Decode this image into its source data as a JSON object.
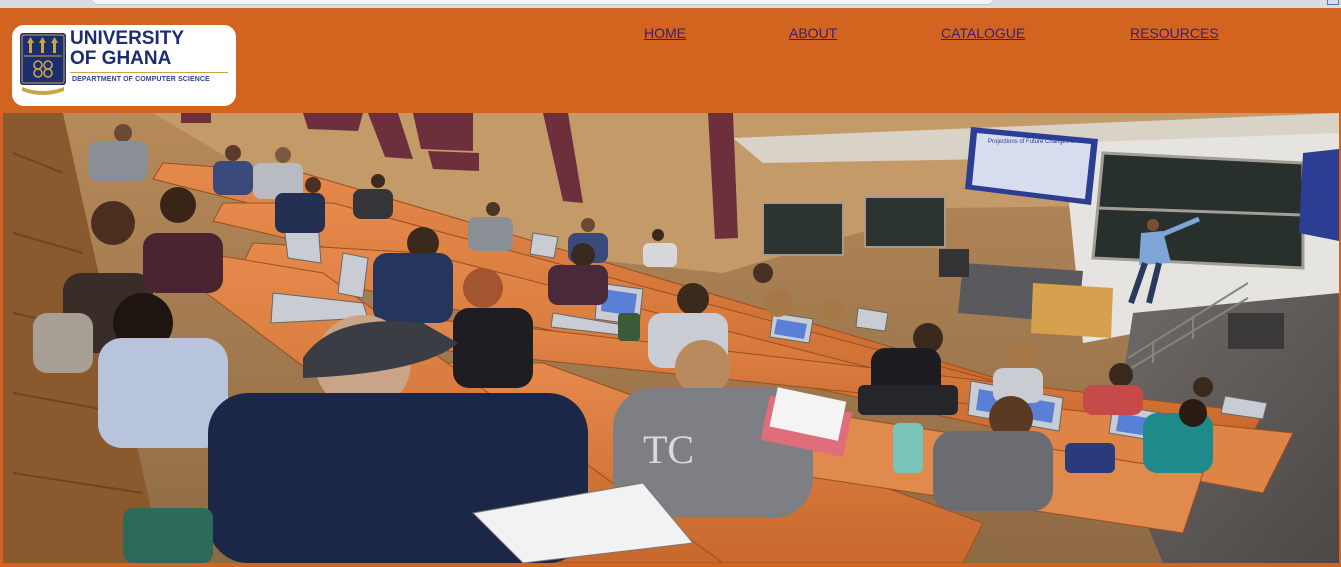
{
  "logo": {
    "title_line1": "UNIVERSITY",
    "title_line2": "OF GHANA",
    "subtitle": "DEPARTMENT OF COMPUTER SCIENCE",
    "icon": "university-crest-icon"
  },
  "nav": {
    "items": [
      {
        "label": "HOME"
      },
      {
        "label": "ABOUT"
      },
      {
        "label": "CATALOGUE"
      },
      {
        "label": "RESOURCES"
      }
    ]
  },
  "hero": {
    "slide_text": "Projections of Future Changes in Climate"
  },
  "colors": {
    "header_bg": "#d2641f",
    "nav_link": "#3a1d77",
    "logo_text": "#1c2e6e"
  }
}
